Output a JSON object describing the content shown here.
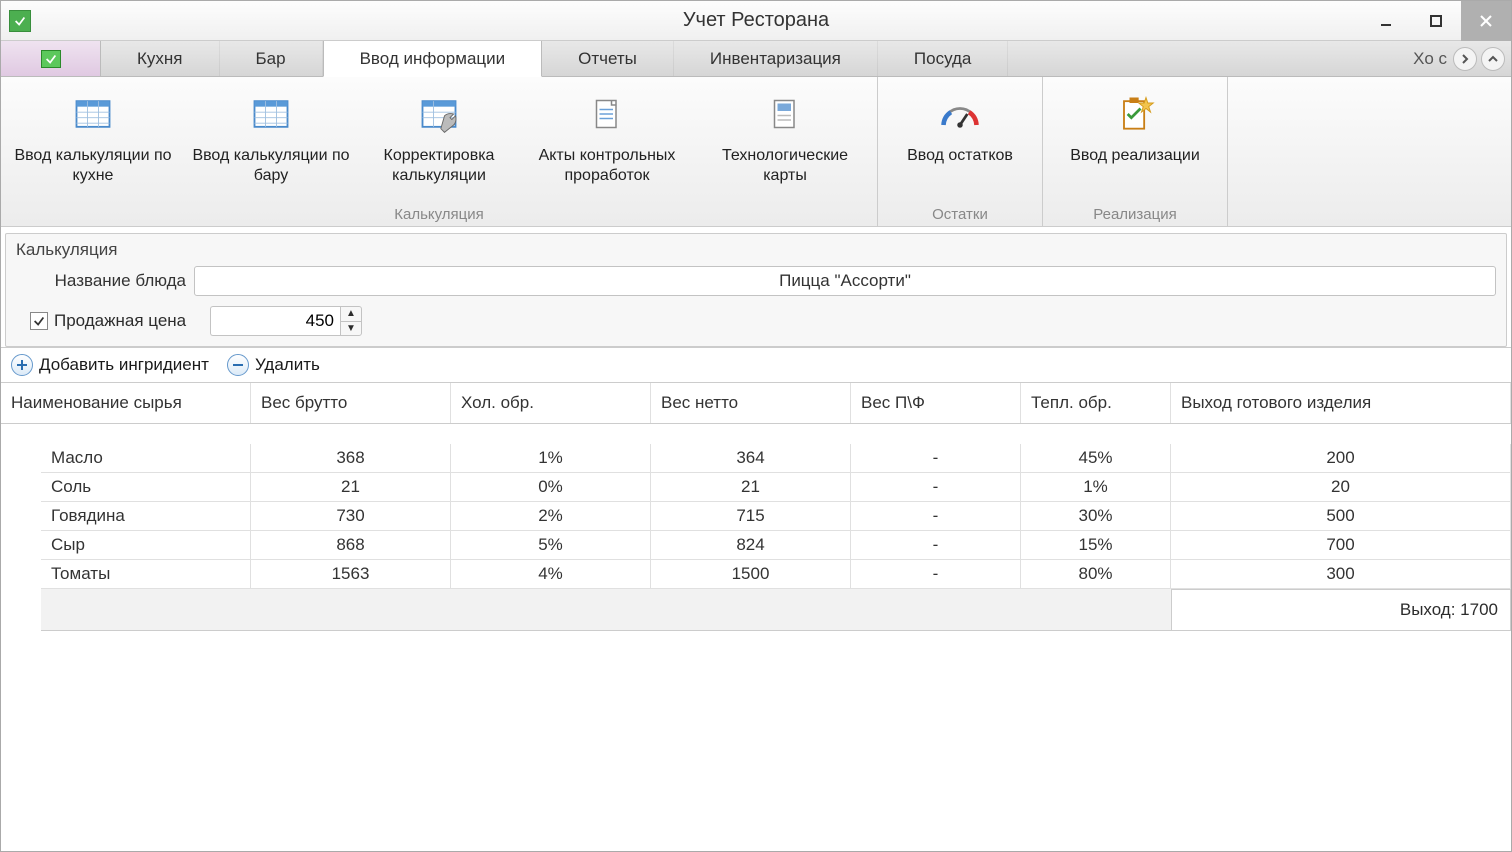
{
  "window": {
    "title": "Учет Ресторана"
  },
  "tabs": {
    "home_icon": "check",
    "items": [
      "Кухня",
      "Бар",
      "Ввод информации",
      "Отчеты",
      "Инвентаризация",
      "Посуда"
    ],
    "overflow": "Хо с",
    "active_index": 2
  },
  "ribbon": {
    "groups": [
      {
        "label": "Калькуляция",
        "buttons": [
          {
            "icon": "grid",
            "label": "Ввод калькуляции по кухне"
          },
          {
            "icon": "grid",
            "label": "Ввод калькуляции по бару"
          },
          {
            "icon": "grid-wrench",
            "label": "Корректировка калькуляции"
          },
          {
            "icon": "doc-lines",
            "label": "Акты контрольных проработок"
          },
          {
            "icon": "doc-page",
            "label": "Технологические карты"
          }
        ]
      },
      {
        "label": "Остатки",
        "buttons": [
          {
            "icon": "gauge",
            "label": "Ввод остатков"
          }
        ]
      },
      {
        "label": "Реализация",
        "buttons": [
          {
            "icon": "clipboard-star",
            "label": "Ввод реализации"
          }
        ]
      }
    ]
  },
  "form": {
    "panel_title": "Калькуляция",
    "name_label": "Название блюда",
    "name_value": "Пицца \"Ассорти\"",
    "price_label": "Продажная цена",
    "price_checked": true,
    "price_value": "450"
  },
  "actions": {
    "add_label": "Добавить ингридиент",
    "delete_label": "Удалить"
  },
  "table": {
    "columns": [
      "Наименование сырья",
      "Вес брутто",
      "Хол. обр.",
      "Вес нетто",
      "Вес П\\Ф",
      "Тепл. обр.",
      "Выход готового изделия"
    ],
    "rows": [
      {
        "name": "Масло",
        "gross": "368",
        "cold": "1%",
        "net": "364",
        "pf": "-",
        "heat": "45%",
        "out": "200"
      },
      {
        "name": "Соль",
        "gross": "21",
        "cold": "0%",
        "net": "21",
        "pf": "-",
        "heat": "1%",
        "out": "20"
      },
      {
        "name": "Говядина",
        "gross": "730",
        "cold": "2%",
        "net": "715",
        "pf": "-",
        "heat": "30%",
        "out": "500"
      },
      {
        "name": "Сыр",
        "gross": "868",
        "cold": "5%",
        "net": "824",
        "pf": "-",
        "heat": "15%",
        "out": "700"
      },
      {
        "name": "Томаты",
        "gross": "1563",
        "cold": "4%",
        "net": "1500",
        "pf": "-",
        "heat": "80%",
        "out": "300"
      }
    ],
    "summary_label": "Выход: 1700"
  }
}
